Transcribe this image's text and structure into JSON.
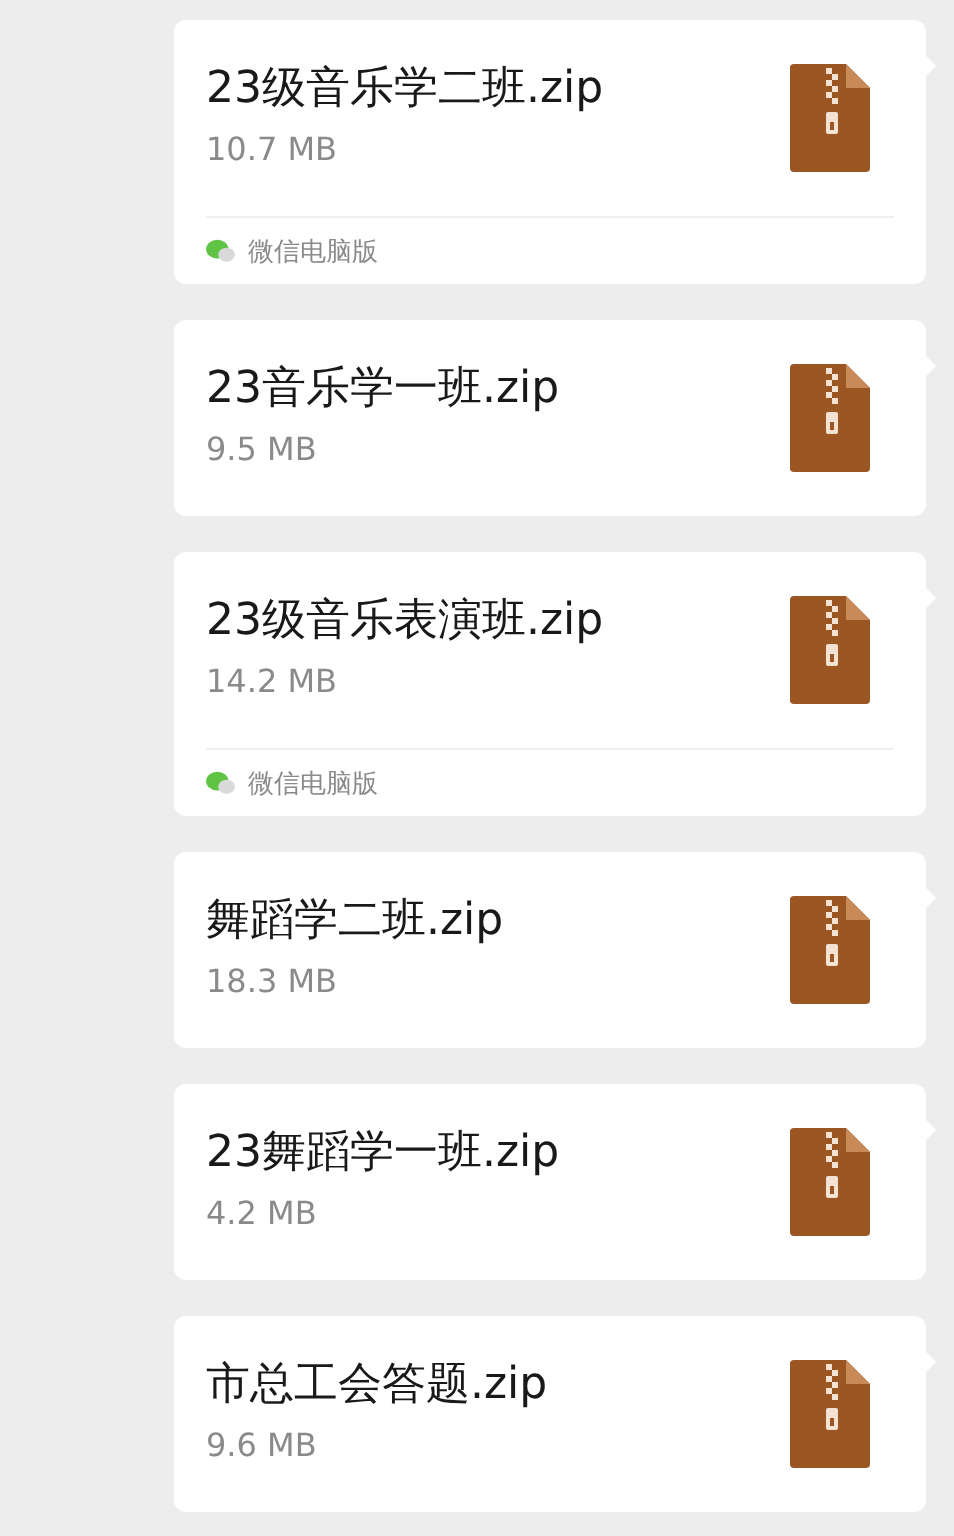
{
  "messages": [
    {
      "file_name": "23级音乐学二班.zip",
      "size": "10.7 MB",
      "source": "微信电脑版"
    },
    {
      "file_name": "23音乐学一班.zip",
      "size": "9.5 MB"
    },
    {
      "file_name": "23级音乐表演班.zip",
      "size": "14.2 MB",
      "source": "微信电脑版"
    },
    {
      "file_name": "舞蹈学二班.zip",
      "size": "18.3 MB"
    },
    {
      "file_name": "23舞蹈学一班.zip",
      "size": "4.2 MB"
    },
    {
      "file_name": "市总工会答题.zip",
      "size": "9.6 MB"
    }
  ]
}
